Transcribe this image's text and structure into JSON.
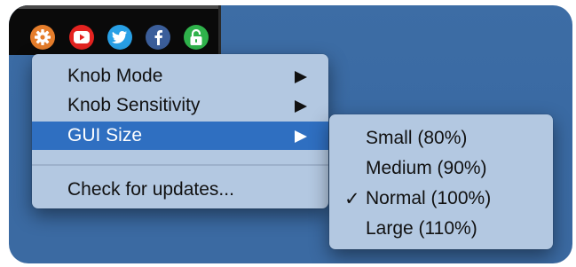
{
  "colors": {
    "desktop": "#3c6ba4",
    "menu_bg": "#b3c8e1",
    "highlight": "#2f6fc1",
    "settings_icon": "#e57d2b",
    "youtube_icon": "#e42320",
    "twitter_icon": "#28a0e6",
    "facebook_icon": "#3b5e9a",
    "lock_icon": "#2fb24b"
  },
  "toolbar": {
    "icons": [
      "gear-icon",
      "youtube-icon",
      "twitter-icon",
      "facebook-icon",
      "unlock-icon"
    ]
  },
  "menu": {
    "items": [
      {
        "label": "Knob Mode",
        "has_submenu": true,
        "highlighted": false
      },
      {
        "label": "Knob Sensitivity",
        "has_submenu": true,
        "highlighted": false
      },
      {
        "label": "GUI Size",
        "has_submenu": true,
        "highlighted": true
      },
      {
        "label": "Check for updates...",
        "has_submenu": false,
        "highlighted": false
      }
    ]
  },
  "submenu": {
    "items": [
      {
        "label": "Small (80%)",
        "checked": false
      },
      {
        "label": "Medium (90%)",
        "checked": false
      },
      {
        "label": "Normal (100%)",
        "checked": true
      },
      {
        "label": "Large (110%)",
        "checked": false
      }
    ],
    "check_mark": "✓"
  }
}
